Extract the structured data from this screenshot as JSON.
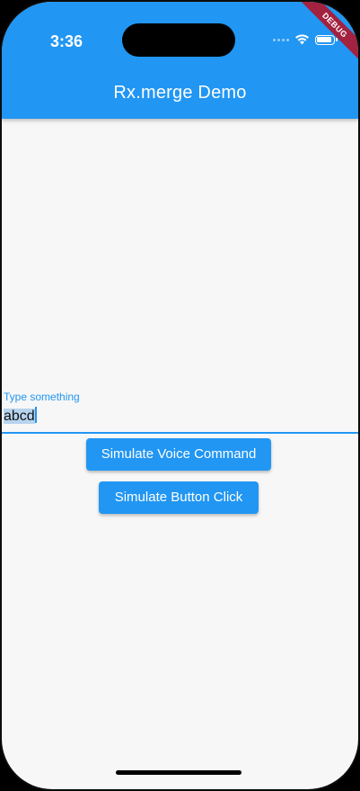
{
  "status_bar": {
    "time": "3:36"
  },
  "app_bar": {
    "title": "Rx.merge Demo",
    "color": "#2196f3"
  },
  "debug_banner": {
    "label": "DEBUG"
  },
  "text_field": {
    "label": "Type something",
    "value": "abcd"
  },
  "buttons": {
    "voice_command": "Simulate Voice Command",
    "button_click": "Simulate Button Click"
  }
}
